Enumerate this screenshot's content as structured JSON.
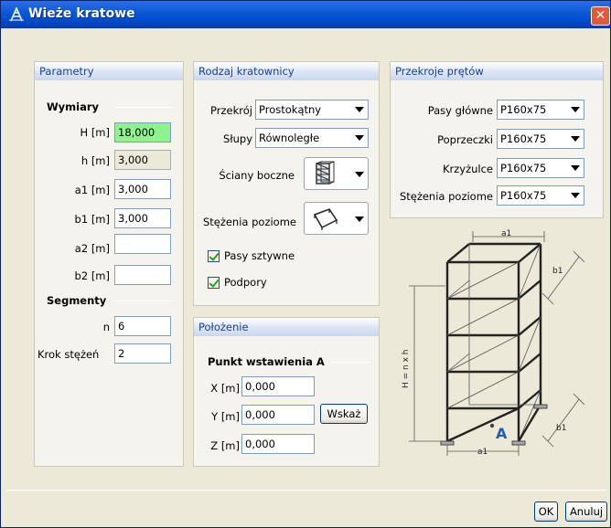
{
  "window": {
    "title": "Wieże kratowe",
    "close_label": "✕"
  },
  "parametry": {
    "header": "Parametry",
    "wymiary_title": "Wymiary",
    "fields": [
      {
        "label": "H [m]",
        "value": "18,000"
      },
      {
        "label": "h [m]",
        "value": "3,000"
      },
      {
        "label": "a1 [m]",
        "value": "3,000"
      },
      {
        "label": "b1 [m]",
        "value": "3,000"
      },
      {
        "label": "a2 [m]",
        "value": ""
      },
      {
        "label": "b2 [m]",
        "value": ""
      }
    ],
    "segmenty_title": "Segmenty",
    "n_label": "n",
    "n_value": "6",
    "krok_label": "Krok stężeń",
    "krok_value": "2"
  },
  "rodzaj": {
    "header": "Rodzaj kratownicy",
    "przekroj_label": "Przekrój",
    "przekroj_value": "Prostokątny",
    "slupy_label": "Słupy",
    "slupy_value": "Równoległe",
    "sciany_label": "Ściany boczne",
    "stezenia_label": "Stężenia poziome",
    "pasy_label": "Pasy sztywne",
    "podpory_label": "Podpory"
  },
  "przekroje": {
    "header": "Przekroje prętów",
    "rows": [
      {
        "label": "Pasy główne",
        "value": "P160x75"
      },
      {
        "label": "Poprzeczki",
        "value": "P160x75"
      },
      {
        "label": "Krzyżulce",
        "value": "P160x75"
      },
      {
        "label": "Stężenia poziome",
        "value": "P160x75"
      }
    ]
  },
  "polozenie": {
    "header": "Położenie",
    "punkt_title": "Punkt wstawienia A",
    "x_label": "X [m]",
    "x_value": "0,000",
    "y_label": "Y [m]",
    "y_value": "0,000",
    "z_label": "Z [m]",
    "z_value": "0,000",
    "wskaz_label": "Wskaż"
  },
  "diagram": {
    "a1_top": "a1",
    "a1_bottom": "a1",
    "b1_top": "b1",
    "b1_bottom": "b1",
    "height_label": "H = n x h",
    "point_label": "A"
  },
  "buttons": {
    "ok": "OK",
    "cancel": "Anuluj"
  },
  "colors": {
    "titlebar": "#0a5bd6",
    "active_field": "#8ef28e",
    "header_text": "#1d3f8c",
    "point_blue": "#1e5fb4"
  }
}
